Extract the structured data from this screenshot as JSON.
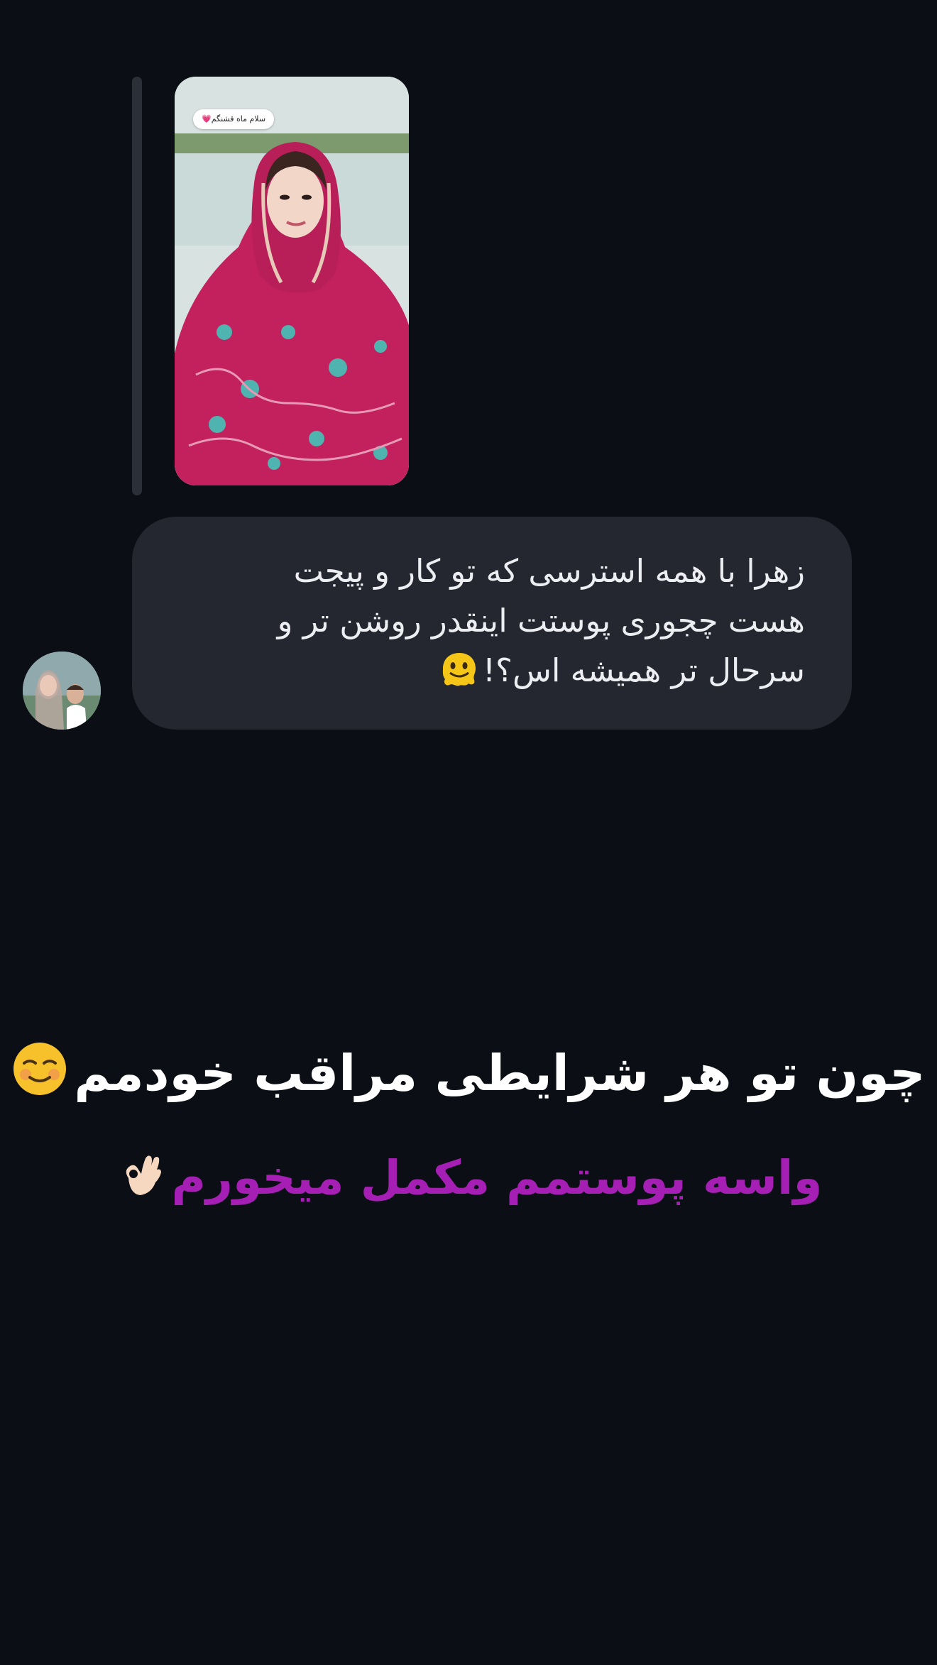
{
  "story": {
    "sticker_text": "سلام ماه قشنگم",
    "colors": {
      "sky": "#d9e3e2",
      "shawl": "#c2215e",
      "pattern": "#4fb3b0"
    }
  },
  "message": {
    "line1": "زهرا با همه استرسی که تو کار و پیجت",
    "line2": "هست چجوری پوستت اینقدر روشن تر و",
    "line3": "سرحال تر همیشه اس؟!",
    "emoji": "melting-face-icon",
    "bubble_color": "#24272f",
    "text_color": "#eceef2"
  },
  "avatar": {
    "icon": "avatar-photo"
  },
  "captions": {
    "line1": "چون تو هر شرایطی مراقب خودمم",
    "line1_emoji": "smiling-face-icon",
    "line1_color": "#ffffff",
    "line2": "واسه پوستمم مکمل میخورم",
    "line2_emoji": "ok-hand-icon",
    "line2_color": "#a61fb5"
  },
  "background_color": "#0b0e15"
}
